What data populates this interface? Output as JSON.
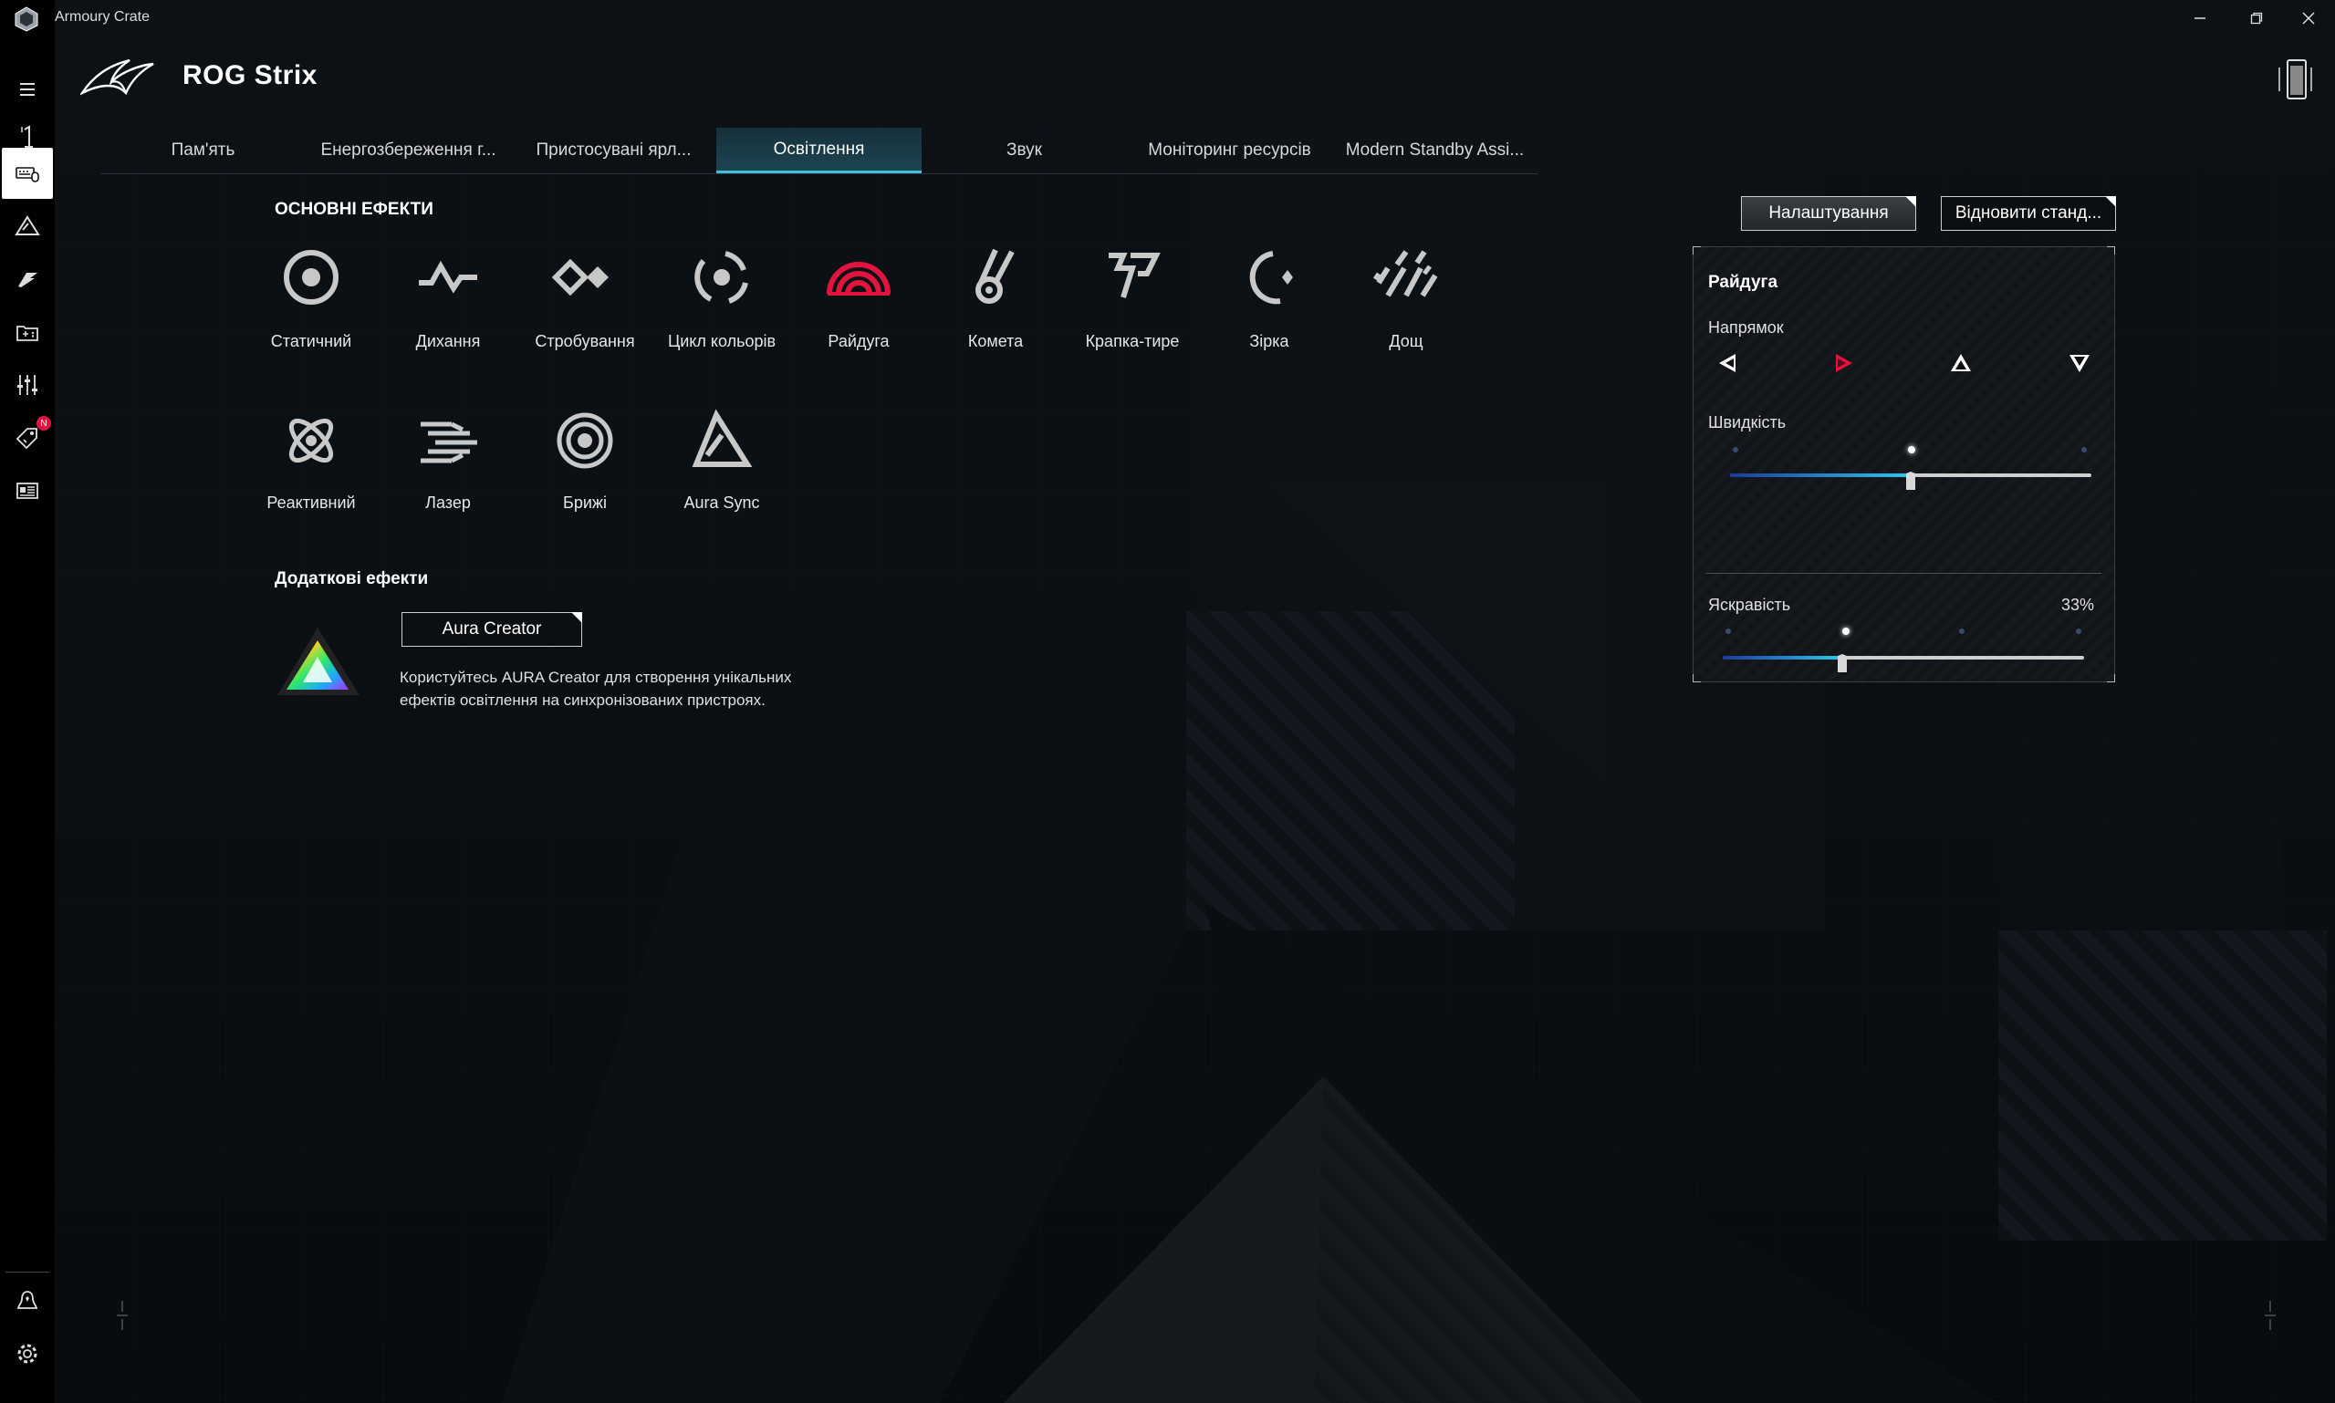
{
  "window": {
    "title": "Armoury Crate",
    "minimize_icon": "minimize-icon",
    "maximize_icon": "restore-icon",
    "close_icon": "close-icon"
  },
  "header": {
    "device_name": "ROG Strix"
  },
  "sidebar": {
    "badge": "N"
  },
  "tabs": [
    {
      "label": "Пам'ять",
      "active": false
    },
    {
      "label": "Енергозбереження г...",
      "active": false
    },
    {
      "label": "Пристосувані ярл...",
      "active": false
    },
    {
      "label": "Освітлення",
      "active": true
    },
    {
      "label": "Звук",
      "active": false
    },
    {
      "label": "Моніторинг ресурсів",
      "active": false
    },
    {
      "label": "Modern Standby Assi...",
      "active": false
    }
  ],
  "basic_effects": {
    "title": "ОСНОВНІ ЕФЕКТИ",
    "items": [
      {
        "label": "Статичний",
        "icon": "static-icon",
        "selected": false
      },
      {
        "label": "Дихання",
        "icon": "breathing-icon",
        "selected": false
      },
      {
        "label": "Стробування",
        "icon": "strobing-icon",
        "selected": false
      },
      {
        "label": "Цикл кольорів",
        "icon": "color-cycle-icon",
        "selected": false
      },
      {
        "label": "Райдуга",
        "icon": "rainbow-icon",
        "selected": true
      },
      {
        "label": "Комета",
        "icon": "comet-icon",
        "selected": false
      },
      {
        "label": "Крапка-тире",
        "icon": "flash-and-dash-icon",
        "selected": false
      },
      {
        "label": "Зірка",
        "icon": "starry-night-icon",
        "selected": false
      },
      {
        "label": "Дощ",
        "icon": "rain-icon",
        "selected": false
      },
      {
        "label": "Реактивний",
        "icon": "reactive-icon",
        "selected": false
      },
      {
        "label": "Лазер",
        "icon": "laser-icon",
        "selected": false
      },
      {
        "label": "Брижі",
        "icon": "ripple-icon",
        "selected": false
      },
      {
        "label": "Aura Sync",
        "icon": "aura-sync-icon",
        "selected": false
      }
    ]
  },
  "additional_effects": {
    "title": "Додаткові ефекти",
    "button_label": "Aura Creator",
    "description": "Користуйтесь AURA Creator для створення унікальних ефектів освітлення на синхронізованих пристроях."
  },
  "actions": {
    "settings_label": "Налаштування",
    "restore_label": "Відновити станд..."
  },
  "panel": {
    "title": "Райдуга",
    "direction_label": "Напрямок",
    "directions": [
      {
        "icon": "arrow-left-icon",
        "selected": false
      },
      {
        "icon": "arrow-right-icon",
        "selected": true
      },
      {
        "icon": "arrow-up-icon",
        "selected": false
      },
      {
        "icon": "arrow-down-icon",
        "selected": false
      }
    ],
    "speed_label": "Швидкість",
    "speed_level": 0.5,
    "brightness_label": "Яскравість",
    "brightness_value": "33%",
    "brightness_level": 0.33
  },
  "colors": {
    "accent": "#3fc0d8",
    "selected": "#e0143c"
  }
}
